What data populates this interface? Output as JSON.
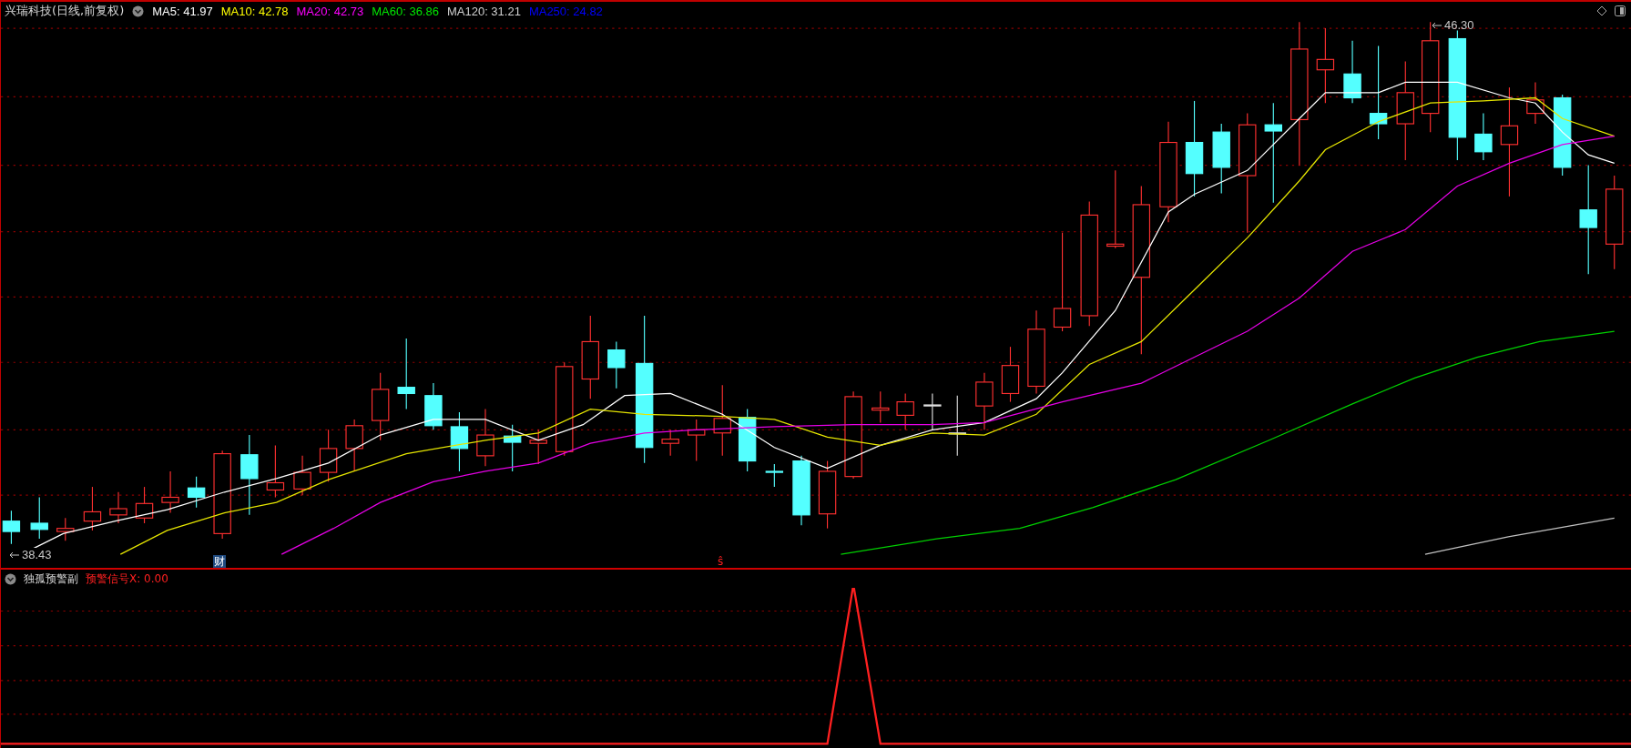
{
  "window": {
    "title": "兴瑞科技(日线,前复权)"
  },
  "main_chart": {
    "ma_legend": [
      {
        "label": "MA5: 41.97",
        "color": "#ffffff"
      },
      {
        "label": "MA10: 42.78",
        "color": "#ffff00"
      },
      {
        "label": "MA20: 42.73",
        "color": "#ff00ff"
      },
      {
        "label": "MA60: 36.86",
        "color": "#00e600"
      },
      {
        "label": "MA120: 31.21",
        "color": "#d0d0d0"
      },
      {
        "label": "MA250: 24.82",
        "color": "#0000ff"
      }
    ],
    "price_labels": [
      {
        "text": "46.30",
        "kind": "high"
      },
      {
        "text": "38.43",
        "kind": "low"
      }
    ],
    "event_markers": [
      {
        "text": "财",
        "kind": "finance"
      },
      {
        "text": "ŝ",
        "kind": "dollar"
      }
    ]
  },
  "indicator_panel": {
    "title": "独孤预警副",
    "reading": "预警信号X: 0.00"
  }
}
